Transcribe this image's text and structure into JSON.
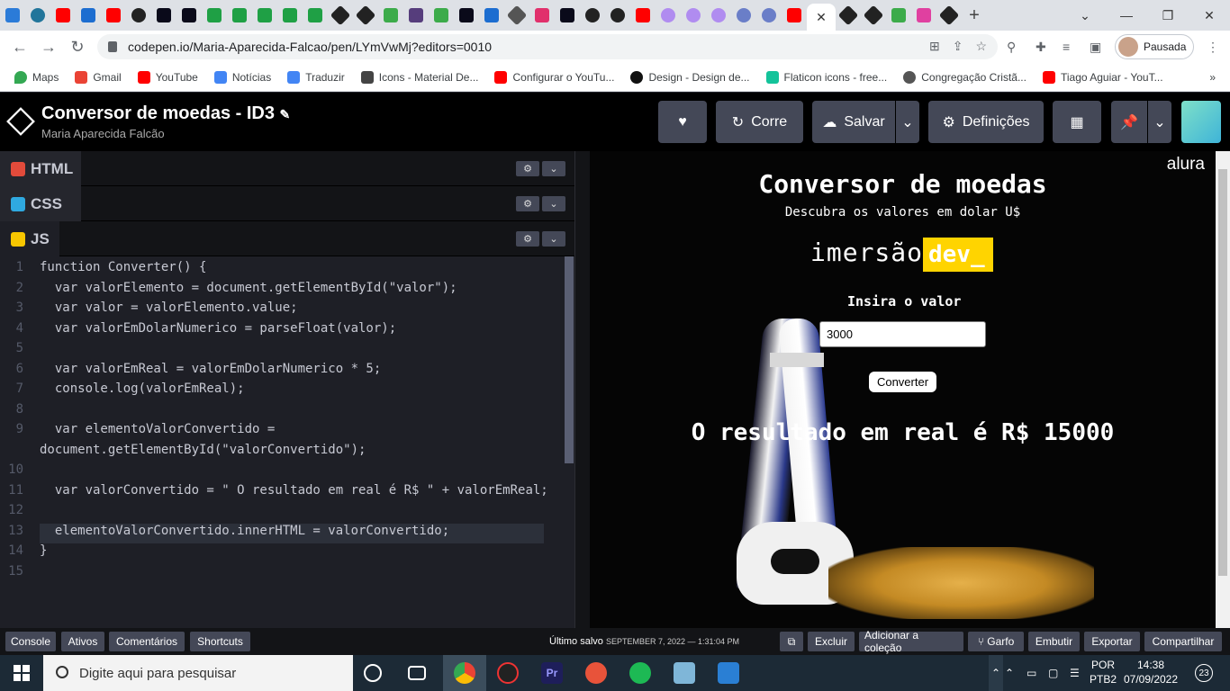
{
  "browser": {
    "url": "codepen.io/Maria-Aparecida-Falcao/pen/LYmVwMj?editors=0010",
    "profile_label": "Pausada",
    "close_tab_glyph": "✕",
    "new_tab_glyph": "+",
    "bookmarks": [
      {
        "label": "Maps",
        "color": "#34a853"
      },
      {
        "label": "Gmail",
        "color": "#ea4335"
      },
      {
        "label": "YouTube",
        "color": "#ff0000"
      },
      {
        "label": "Notícias",
        "color": "#4285f4"
      },
      {
        "label": "Traduzir",
        "color": "#4285f4"
      },
      {
        "label": "Icons - Material De...",
        "color": "#000000"
      },
      {
        "label": "Configurar o YouTu...",
        "color": "#ff0000"
      },
      {
        "label": "Design - Design de...",
        "color": "#000000"
      },
      {
        "label": "Flaticon icons - free...",
        "color": "#13c39a"
      },
      {
        "label": "Congregação Cristã...",
        "color": "#555555"
      },
      {
        "label": "Tiago Aguiar - YouT...",
        "color": "#ff0000"
      }
    ]
  },
  "codepen": {
    "title": "Conversor de moedas - ID3",
    "author": "Maria Aparecida Falcão",
    "buttons": {
      "run": "Corre",
      "save": "Salvar",
      "settings": "Definições"
    },
    "panes": {
      "html": "HTML",
      "css": "CSS",
      "js": "JS"
    },
    "code_lines": [
      "function Converter() {",
      "  var valorElemento = document.getElementById(\"valor\");",
      "  var valor = valorElemento.value;",
      "  var valorEmDolarNumerico = parseFloat(valor);",
      "",
      "  var valorEmReal = valorEmDolarNumerico * 5;",
      "  console.log(valorEmReal);",
      "",
      "  var elementoValorConvertido =",
      "document.getElementById(\"valorConvertido\");",
      "",
      "  var valorConvertido = \" O resultado em real é R$ \" + valorEmReal;",
      "",
      "  elementoValorConvertido.innerHTML = valorConvertido;",
      "}",
      ""
    ],
    "line_numbers": [
      "1",
      "2",
      "3",
      "4",
      "5",
      "6",
      "7",
      "8",
      "9",
      "",
      "10",
      "11",
      "12",
      "13",
      "14",
      "15"
    ],
    "footer": {
      "console": "Console",
      "assets": "Ativos",
      "comments": "Comentários",
      "shortcuts": "Shortcuts",
      "saved_label": "Último salvo",
      "saved_time": "SEPTEMBER 7, 2022 — 1:31:04 PM",
      "delete": "Excluir",
      "add_collection": "Adicionar a coleção",
      "fork": "Garfo",
      "embed": "Embutir",
      "export": "Exportar",
      "share": "Compartilhar"
    }
  },
  "preview": {
    "brand": "alura",
    "heading": "Conversor de moedas",
    "subheading": "Descubra os valores em dolar U$",
    "imersao": "imersão",
    "dev": "dev_",
    "input_label": "Insira o valor",
    "input_value": "3000",
    "convert_button": "Converter",
    "result": "O resultado em real é R$ 15000"
  },
  "taskbar": {
    "search_placeholder": "Digite aqui para pesquisar",
    "lang": "POR",
    "layout": "PTB2",
    "time": "14:38",
    "date": "07/09/2022",
    "notifications": "23"
  }
}
